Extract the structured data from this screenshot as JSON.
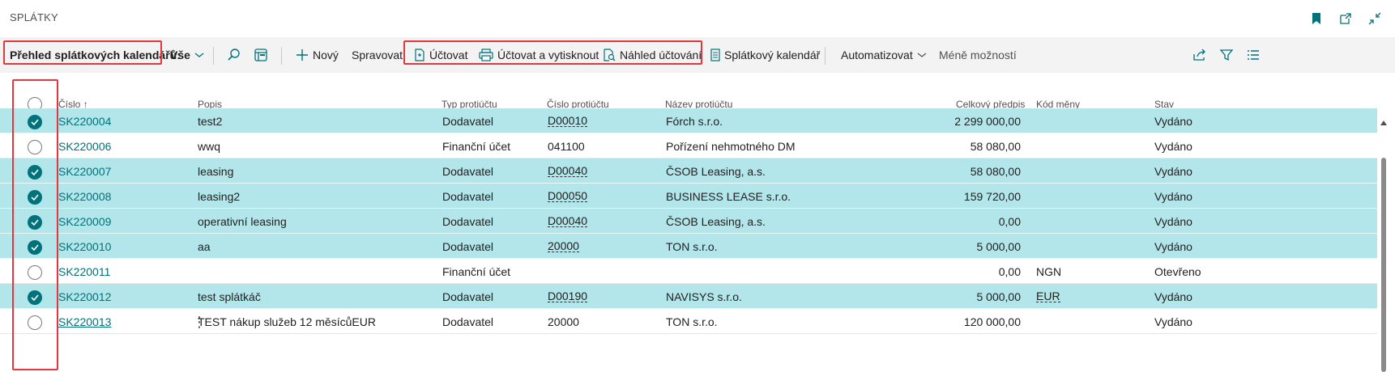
{
  "page": {
    "title": "SPLÁTKY"
  },
  "title_icons": [
    "bookmark-icon",
    "open-in-new-window-icon",
    "collapse-icon"
  ],
  "actions": {
    "view_label": "Přehled splátkových kalendářů:",
    "view_selector": "Vše",
    "search_icon": "search-icon",
    "layout_icon": "filter-pane-icon",
    "new": "Nový",
    "manage": "Spravovat",
    "post": "Účtovat",
    "post_print": "Účtovat a vytisknout",
    "post_preview": "Náhled účtování",
    "calendar": "Splátkový kalendář",
    "automate": "Automatizovat",
    "fewer_options": "Méně možností",
    "share_icon": "share-icon",
    "filter_icon": "filter-icon",
    "list_icon": "list-view-icon"
  },
  "columns": {
    "number": "Číslo",
    "sort_indicator": "↑",
    "description": "Popis",
    "account_type": "Typ protiúčtu",
    "account_no": "Číslo protiúčtu",
    "account_name": "Název protiúčtu",
    "total": "Celkový předpis",
    "currency": "Kód měny",
    "status": "Stav"
  },
  "rows": [
    {
      "selected": true,
      "number": "SK220004",
      "description": "test2",
      "account_type": "Dodavatel",
      "account_no": "D00010",
      "account_name": "Fórch s.r.o.",
      "total": "2 299 000,00",
      "currency": "",
      "status": "Vydáno"
    },
    {
      "selected": false,
      "number": "SK220006",
      "description": "wwq",
      "account_type": "Finanční účet",
      "account_no": "041100",
      "account_name": "Pořízení nehmotného DM",
      "total": "58 080,00",
      "currency": "",
      "status": "Vydáno"
    },
    {
      "selected": true,
      "number": "SK220007",
      "description": "leasing",
      "account_type": "Dodavatel",
      "account_no": "D00040",
      "account_name": "ČSOB Leasing, a.s.",
      "total": "58 080,00",
      "currency": "",
      "status": "Vydáno"
    },
    {
      "selected": true,
      "number": "SK220008",
      "description": "leasing2",
      "account_type": "Dodavatel",
      "account_no": "D00050",
      "account_name": "BUSINESS LEASE  s.r.o.",
      "total": "159 720,00",
      "currency": "",
      "status": "Vydáno"
    },
    {
      "selected": true,
      "number": "SK220009",
      "description": "operativní leasing",
      "account_type": "Dodavatel",
      "account_no": "D00040",
      "account_name": "ČSOB Leasing, a.s.",
      "total": "0,00",
      "currency": "",
      "status": "Vydáno"
    },
    {
      "selected": true,
      "number": "SK220010",
      "description": "aa",
      "account_type": "Dodavatel",
      "account_no": "20000",
      "account_name": "TON s.r.o.",
      "total": "5 000,00",
      "currency": "",
      "status": "Vydáno"
    },
    {
      "selected": false,
      "number": "SK220011",
      "description": "",
      "account_type": "Finanční účet",
      "account_no": "",
      "account_name": "",
      "total": "0,00",
      "currency": "NGN",
      "status": "Otevřeno"
    },
    {
      "selected": true,
      "number": "SK220012",
      "description": "test splátkáč",
      "account_type": "Dodavatel",
      "account_no": "D00190",
      "account_name": "NAVISYS s.r.o.",
      "total": "5 000,00",
      "currency": "EUR",
      "status": "Vydáno"
    },
    {
      "selected": false,
      "number": "SK220013",
      "description": "TEST nákup služeb 12 měsícůEUR",
      "account_type": "Dodavatel",
      "account_no": "20000",
      "account_name": "TON s.r.o.",
      "total": "120 000,00",
      "currency": "",
      "status": "Vydáno"
    }
  ],
  "colors": {
    "accent": "#00727a",
    "selected_row": "#b2e6ea",
    "highlight_box": "#e0383e"
  }
}
